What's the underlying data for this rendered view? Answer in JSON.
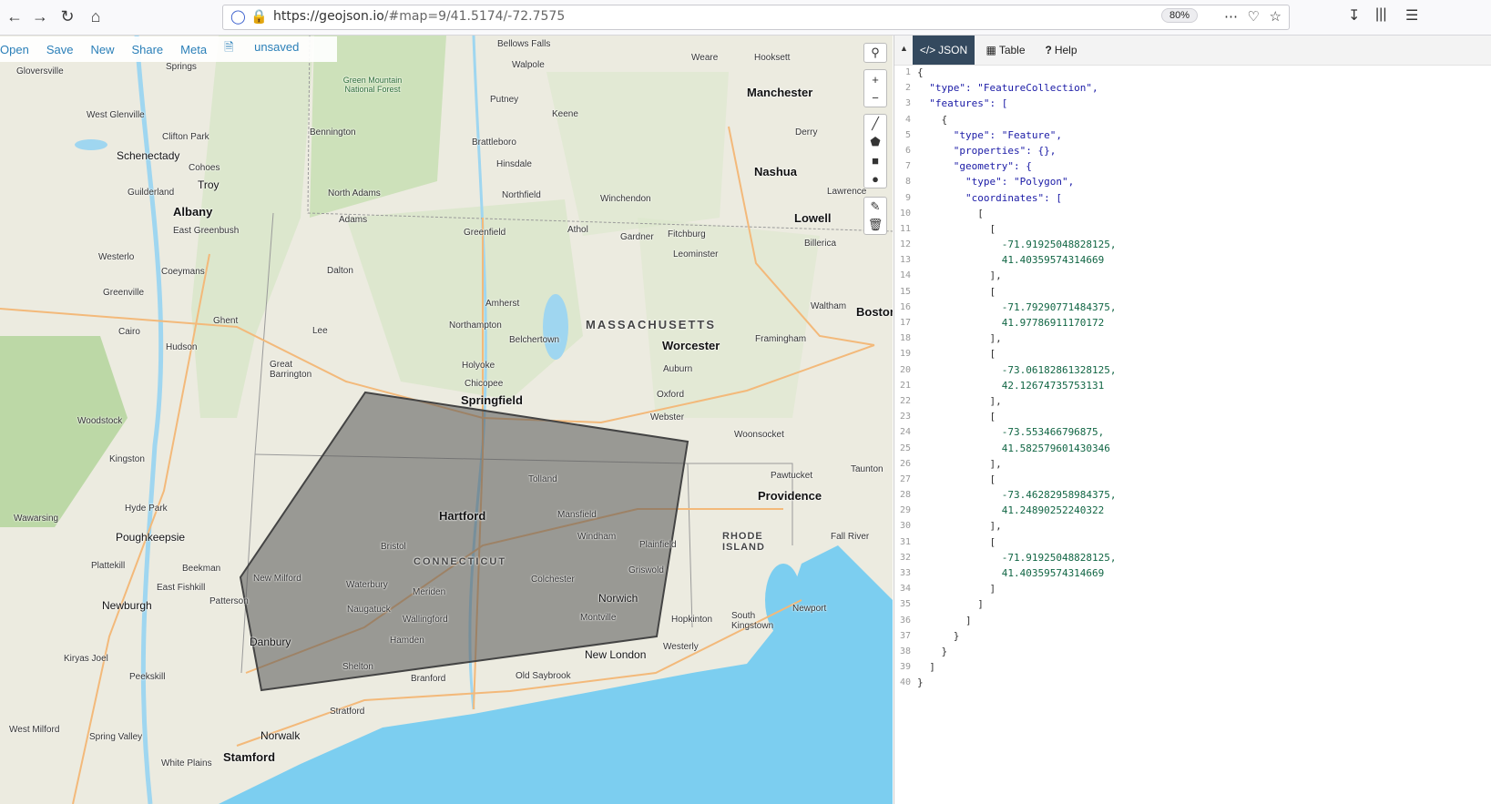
{
  "browser": {
    "url_host": "https://geojson.io",
    "url_path": "/#map=9/41.5174/-72.7575",
    "zoom": "80%"
  },
  "toolbar": {
    "open": "Open",
    "save": "Save",
    "new": "New",
    "share": "Share",
    "meta": "Meta",
    "status": "unsaved"
  },
  "map": {
    "states": [
      "MASSACHUSETTS",
      "CONNECTICUT",
      "RHODE ISLAND"
    ],
    "cities_major": [
      "Albany",
      "Springfield",
      "Hartford",
      "Worcester",
      "Providence",
      "Boston",
      "Manchester",
      "Nashua",
      "Lowell",
      "Stamford"
    ],
    "places": [
      "Gloversville",
      "West Glenville",
      "Clifton Park",
      "Schenectady",
      "Cohoes",
      "Troy",
      "Guilderland",
      "East Greenbush",
      "Westerlo",
      "Coeymans",
      "Greenville",
      "Cairo",
      "Ghent",
      "Hudson",
      "Woodstock",
      "Kingston",
      "Hyde Park",
      "Wawarsing",
      "Poughkeepsie",
      "Plattekill",
      "Beekman",
      "East Fishkill",
      "Newburgh",
      "Patterson",
      "Kiryas Joel",
      "Peekskill",
      "West Milford",
      "Spring Valley",
      "White Plains",
      "Norwalk",
      "Stratford",
      "Danbury",
      "New Milford",
      "Waterbury",
      "Naugatuck",
      "Meriden",
      "Wallingford",
      "Hamden",
      "Shelton",
      "Branford",
      "Bristol",
      "Tolland",
      "Mansfield",
      "Windham",
      "Colchester",
      "Norwich",
      "Montville",
      "Plainfield",
      "Griswold",
      "New London",
      "Old Saybrook",
      "Westerly",
      "Hopkinton",
      "South Kingstown",
      "Newport",
      "Fall River",
      "Taunton",
      "Pawtucket",
      "Woonsocket",
      "Webster",
      "Oxford",
      "Auburn",
      "Framingham",
      "Waltham",
      "Billerica",
      "Lawrence",
      "Derry",
      "Hooksett",
      "Weare",
      "Keene",
      "Putney",
      "Walpole",
      "Bellows Falls",
      "Brattleboro",
      "Hinsdale",
      "Northfield",
      "Winchendon",
      "Gardner",
      "Fitchburg",
      "Leominster",
      "Athol",
      "Greenfield",
      "Amherst",
      "Northampton",
      "Belchertown",
      "Holyoke",
      "Chicopee",
      "North Adams",
      "Adams",
      "Dalton",
      "Lee",
      "Great Barrington",
      "Bennington",
      "Springs",
      "Green Mountain National Forest"
    ],
    "search_icon": "search-icon",
    "controls": [
      "zoom-in",
      "zoom-out",
      "draw-line",
      "draw-polygon",
      "draw-rectangle",
      "draw-marker",
      "edit",
      "delete"
    ]
  },
  "panel": {
    "tabs": [
      {
        "label": "JSON",
        "icon": "code-icon"
      },
      {
        "label": "Table",
        "icon": "table-icon"
      },
      {
        "label": "Help",
        "icon": "question-icon"
      }
    ]
  },
  "code_lines": [
    "{",
    "  \"type\": \"FeatureCollection\",",
    "  \"features\": [",
    "    {",
    "      \"type\": \"Feature\",",
    "      \"properties\": {},",
    "      \"geometry\": {",
    "        \"type\": \"Polygon\",",
    "        \"coordinates\": [",
    "          [",
    "            [",
    "              -71.91925048828125,",
    "              41.40359574314669",
    "            ],",
    "            [",
    "              -71.79290771484375,",
    "              41.97786911170172",
    "            ],",
    "            [",
    "              -73.06182861328125,",
    "              42.12674735753131",
    "            ],",
    "            [",
    "              -73.553466796875,",
    "              41.582579601430346",
    "            ],",
    "            [",
    "              -73.46282958984375,",
    "              41.24890252240322",
    "            ],",
    "            [",
    "              -71.91925048828125,",
    "              41.40359574314669",
    "            ]",
    "          ]",
    "        ]",
    "      }",
    "    }",
    "  ]",
    "}"
  ]
}
